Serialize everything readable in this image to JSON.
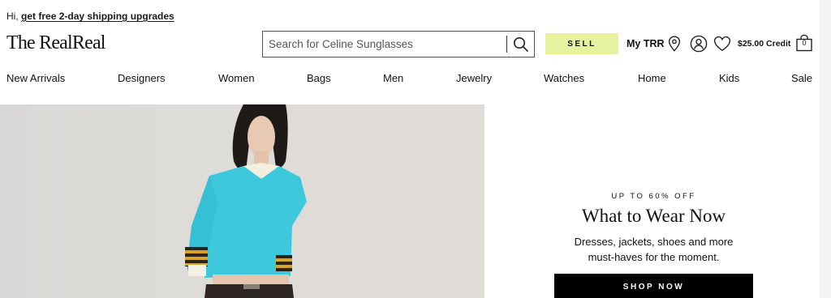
{
  "topbar": {
    "greeting": "Hi,",
    "link": "get free 2-day shipping upgrades"
  },
  "header": {
    "logo": "The RealReal",
    "search_placeholder": "Search for Celine Sunglasses",
    "sell_label": "SELL",
    "my_trr": "My TRR",
    "credit": "$25.00 Credit",
    "bag_count": "0"
  },
  "nav": {
    "items": [
      "New Arrivals",
      "Designers",
      "Women",
      "Bags",
      "Men",
      "Jewelry",
      "Watches",
      "Home",
      "Kids",
      "Sale"
    ]
  },
  "promo": {
    "eyebrow": "UP TO 60% OFF",
    "title": "What to Wear Now",
    "subtitle_line1": "Dresses, jackets, shoes and more",
    "subtitle_line2": "must-haves for the moment.",
    "cta": "SHOP NOW"
  },
  "colors": {
    "sell_bg": "#e6f29f",
    "sweater": "#3ec8dc",
    "cta_bg": "#000000"
  }
}
